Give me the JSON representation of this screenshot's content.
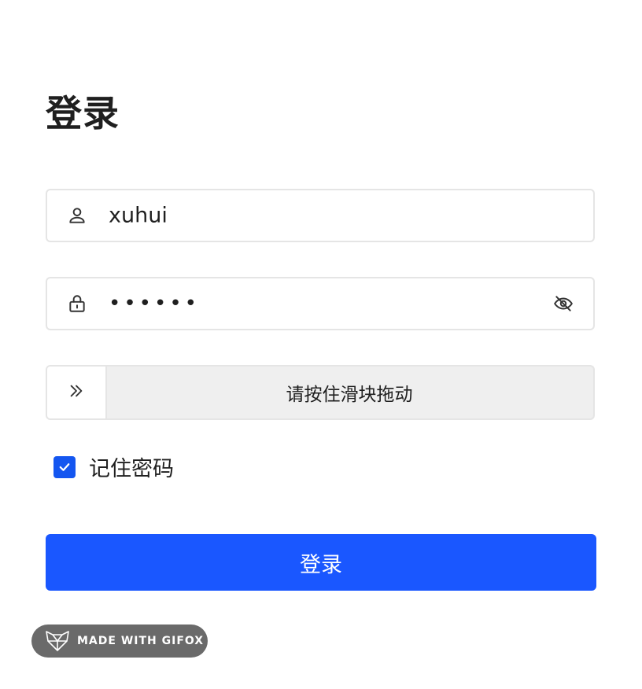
{
  "page": {
    "title": "登录"
  },
  "username": {
    "icon": "user-icon",
    "value": "xuhui"
  },
  "password": {
    "icon": "lock-icon",
    "value": "••••••",
    "visibility_icon": "eye-off-icon"
  },
  "slider": {
    "handle_icon": "double-chevron-right-icon",
    "text": "请按住滑块拖动"
  },
  "remember": {
    "checked": true,
    "label": "记住密码"
  },
  "login_button": {
    "label": "登录"
  },
  "badge": {
    "icon": "fox-logo-icon",
    "text": "MADE WITH GIFOX"
  },
  "colors": {
    "primary": "#1a57ff",
    "checkbox": "#1456f0",
    "border": "#e5e5e5",
    "slider_track": "#efefef",
    "badge_bg": "#6a6a6a"
  }
}
